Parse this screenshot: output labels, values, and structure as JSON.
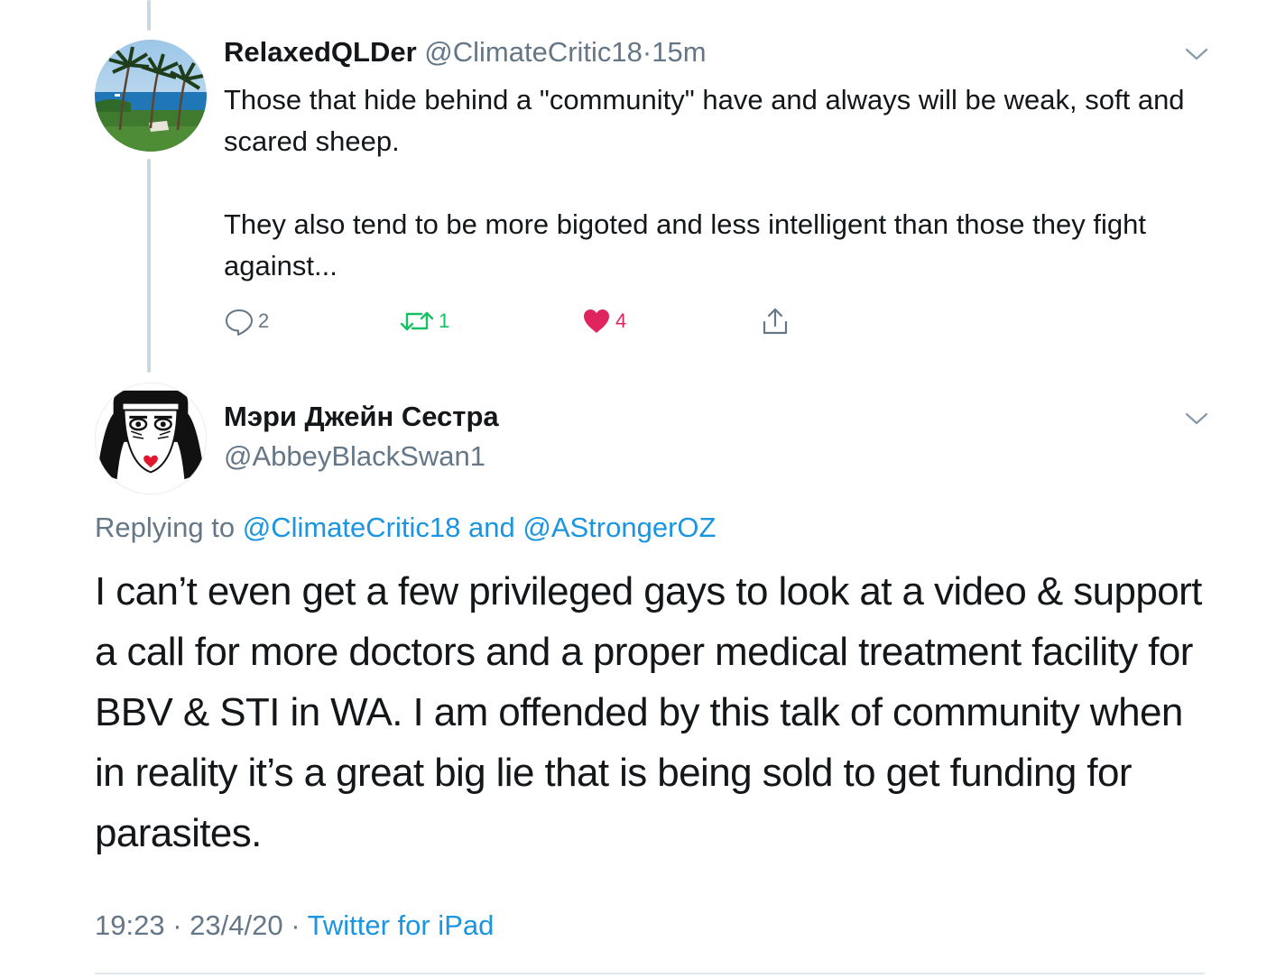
{
  "tweet1": {
    "display_name": "RelaxedQLDer",
    "handle": "@ClimateCritic18",
    "separator": "·",
    "time": "15m",
    "text_lines": [
      "Those that hide behind a \"community\" have and always will be weak, soft and scared sheep.",
      "They also tend to be more bigoted and less intelligent than those they fight against..."
    ],
    "actions": {
      "reply": {
        "icon": "reply-icon",
        "count": "2"
      },
      "retweet": {
        "icon": "retweet-icon",
        "count": "1",
        "color": "#17bf63"
      },
      "like": {
        "icon": "heart-icon",
        "count": "4",
        "color": "#e0245e"
      },
      "share": {
        "icon": "share-icon"
      }
    }
  },
  "tweet2": {
    "display_name": "Мэри Джейн Сестра",
    "handle": "@AbbeyBlackSwan1",
    "replying_prefix": "Replying to",
    "replying_user1": "@ClimateCritic18",
    "replying_and": "and",
    "replying_user2": "@AStrongerOZ",
    "text": "I can’t even get a few privileged gays to look at a video & support a call for more doctors and a proper medical treatment facility for BBV & STI in WA. I am offended by this talk of community when in reality it’s a great big lie that is being sold to get funding for  parasites.",
    "time": "19:23",
    "separator": "·",
    "date": "23/4/20",
    "source": "Twitter for iPad"
  },
  "colors": {
    "link": "#1b95e0",
    "secondary_text": "#657786",
    "thread_line": "#ccd6dd"
  }
}
